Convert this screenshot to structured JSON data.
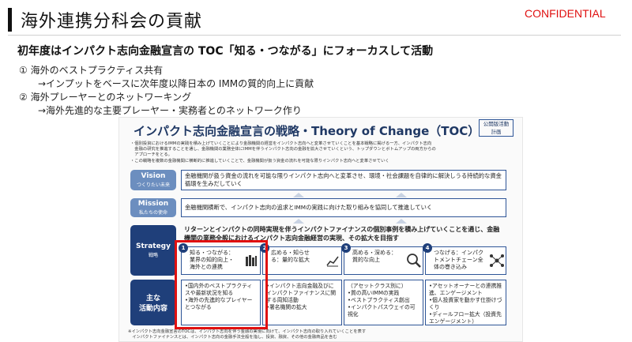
{
  "header": {
    "title": "海外連携分科会の貢献",
    "confidential": "CONFIDENTIAL"
  },
  "subtitle": "初年度はインパクト志向金融宣言の TOC「知る・つながる」にフォーカスして活動",
  "points": [
    {
      "label": "① 海外のベストプラクティス共有",
      "detail": "→インプットをベースに次年度以降日本の IMMの質的向上に貢献"
    },
    {
      "label": "② 海外プレーヤーとのネットワーキング",
      "detail": "→海外先進的な主要プレーヤー・実務者とのネットワーク作り"
    }
  ],
  "toc": {
    "title": "インパクト志向金融宣言の戦略・Theory of Change（TOC）",
    "badge": [
      "公開版活動",
      "計画"
    ],
    "notes": [
      "・個別投資におけるIMMの実践を積み上げていくことにより金融機関の経営をインパクト志向へと変革させていくことを基本戦略に掲げる一方、インパクト志向",
      "　金融の研究を推進することを通し、金融機関の業務全体にIMMを伴うインパクト志向の金融を拡大させていくという、トップダウンとボトムアップの両方からの",
      "　アプローチをとる。",
      "・この戦略を複数の金融機関に横断的に推進していくことで、金融機関が扱う資金の流れを可能な限りインパクト志向へと変革させていく"
    ],
    "vision": {
      "label": "Vision",
      "sublabel": "つくりたい未来",
      "text": "金融機関が扱う資金の流れを可能な限りインパクト志向へと変革させ、環境・社会課題を自律的に解決しうる持続的な資金循環を生みだしていく"
    },
    "mission": {
      "label": "Mission",
      "sublabel": "私たちの使命",
      "text": "金融機関横断で、インパクト志向の追求とIMMの実践に向けた取り組みを協同して推進していく"
    },
    "strategy": {
      "label": "Strategy",
      "sublabel": "戦略",
      "text": "リターンとインパクトの同時実現を伴うインパクトファイナンスの個別事例を積み上げていくことを通じ、金融機関の業務全般におけるインパクト志向金融経営の実現、その拡大を目指す",
      "pillars": [
        {
          "num": "1",
          "text": "知る・つながる：業界の知的向上・海外との連携",
          "icon": "books-icon"
        },
        {
          "num": "2",
          "text": "広める・知らせる：量的な拡大",
          "icon": "growth-chart-icon"
        },
        {
          "num": "3",
          "text": "高める・深める：質的な向上",
          "icon": "magnifier-icon"
        },
        {
          "num": "4",
          "text": "つなげる：インパクトメントチェーン全体の巻き込み",
          "icon": "network-icon"
        }
      ]
    },
    "activities": {
      "label": "主な",
      "sublabel": "活動内容",
      "items": [
        "•国内外のベストプラクティスや最新状況を知る\n•海外の先進的なプレイヤーとつながる",
        "•インパクト志向金融及びにインパクトファイナンスに関する周知活動\n•署名機関の拡大",
        "（アセットクラス別に）\n•質の高いIMMの実践\n•ベストプラクティス創出\n•インパクトパスウェイの可視化",
        "•アセットオーナーとの連携推進、エンゲージメント\n•個人投資家を動かす仕掛けづくり\n•ディールフロー拡大（投資先エンゲージメント）"
      ]
    },
    "footnotes": [
      "※インパクト志向金融宣言のTOCは、インパクト志向を伴う金融の実現に向けて、インパクト志向の取り入れていくことを表す",
      "　インパクトファイナンスとは、インパクト志向の金融手法全般を指し、投資、融資、その他の金融商品を含む"
    ]
  },
  "colors": {
    "accent": "#1f3f7a",
    "light_label": "#6c8ebf",
    "highlight": "#e01010",
    "confidential": "#e01010"
  }
}
